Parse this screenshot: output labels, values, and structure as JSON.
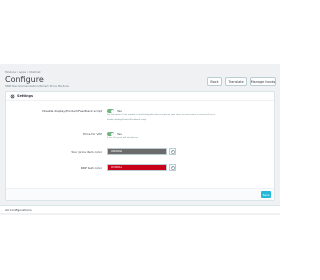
{
  "breadcrumb": "Module  /  apps  /  Wishlist",
  "page": {
    "title": "Configure",
    "subtitle": "SMP Recommendation/Smart Price Module"
  },
  "toolbar": {
    "back_label": "Back",
    "translate_label": "Translate",
    "manage_label": "Manage hooks"
  },
  "panel": {
    "title": "Settings",
    "rows": {
      "display_label": "Disable display/Product/Feedback script",
      "display_value": "Yes",
      "display_help_1": "Set this option if the module is interfering with other scripts on your store. In most cases, it can be left as is.",
      "display_help_2": "Enable display/Product/Feedback script",
      "price_label": "Price for VAT",
      "price_value": "Yes",
      "price_help": "If set, the price will include tax",
      "bg_label": "Your price item color",
      "bg_value": "#6b6b6b",
      "text_label": "RRP text color",
      "text_value": "#c8001a"
    },
    "save_label": "Save"
  },
  "footer": {
    "label": "All Configurations"
  },
  "colors": {
    "accent": "#25b9d7",
    "switch_on": "#70b580",
    "swatch_grey": "#6b6b6b",
    "swatch_red": "#c8001a"
  }
}
